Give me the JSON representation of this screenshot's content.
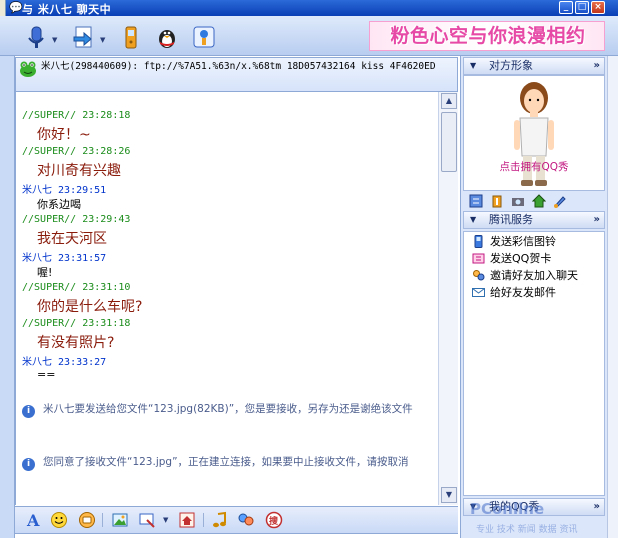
{
  "window": {
    "title": "与 米八七 聊天中",
    "buttons": {
      "minimize": "_",
      "maximize": "□",
      "close": "×"
    }
  },
  "toolbar": {
    "icons": [
      "voice-video-icon",
      "file-transfer-icon",
      "mobile-phone-icon",
      "qq-show-icon",
      "info-icon"
    ],
    "banner_text": "粉色心空与你浪漫相约"
  },
  "contact_header": {
    "text": "米八七(298440609): ftp://%7A51.%63n/x.%68tm 18D057432164 kiss 4F4620ED"
  },
  "messages": [
    {
      "sender": "//SUPER//",
      "time": "23:28:18",
      "text": "你好！~",
      "self": true
    },
    {
      "sender": "//SUPER//",
      "time": "23:28:26",
      "text": "对川奇有兴趣",
      "self": true
    },
    {
      "sender": "米八七",
      "time": "23:29:51",
      "text": "你系边喝",
      "self": false
    },
    {
      "sender": "//SUPER//",
      "time": "23:29:43",
      "text": "我在天河区",
      "self": true
    },
    {
      "sender": "米八七",
      "time": "23:31:57",
      "text": "喔!",
      "self": false
    },
    {
      "sender": "//SUPER//",
      "time": "23:31:10",
      "text": "你的是什么车呢?",
      "self": true
    },
    {
      "sender": "//SUPER//",
      "time": "23:31:18",
      "text": "有没有照片?",
      "self": true
    },
    {
      "sender": "米八七",
      "time": "23:33:27",
      "text": "==",
      "self": false
    }
  ],
  "system_messages": [
    "米八七要发送给您文件“123.jpg(82KB)”，您是要接收，另存为还是谢绝该文件",
    "您同意了接收文件“123.jpg”，正在建立连接，如果要中止接收文件，请按取消"
  ],
  "bottom_toolbar": {
    "icons": [
      "font-icon",
      "emoticon-icon",
      "action-icon",
      "picture-icon",
      "screen-capture-icon",
      "dropdown-icon",
      "home-icon",
      "music-icon",
      "chat-icon",
      "magic-icon"
    ]
  },
  "right_panel": {
    "section1_title": "对方形象",
    "avatar_caption": "点击拥有QQ秀",
    "section2_title": "腾讯服务",
    "services": [
      "发送彩信图铃",
      "发送QQ贺卡",
      "邀请好友加入聊天",
      "给好友发邮件"
    ],
    "section3_title": "我的QQ秀"
  },
  "watermark": {
    "main": "PConline",
    "sub": "专业 技术 新闻 数据 资讯"
  },
  "colors": {
    "titlebar": "#0a3fb5",
    "self_name": "#1a8c1a",
    "peer_name": "#0033cc",
    "self_text": "#8a1c0c",
    "banner_pink": "#e64aa6"
  }
}
